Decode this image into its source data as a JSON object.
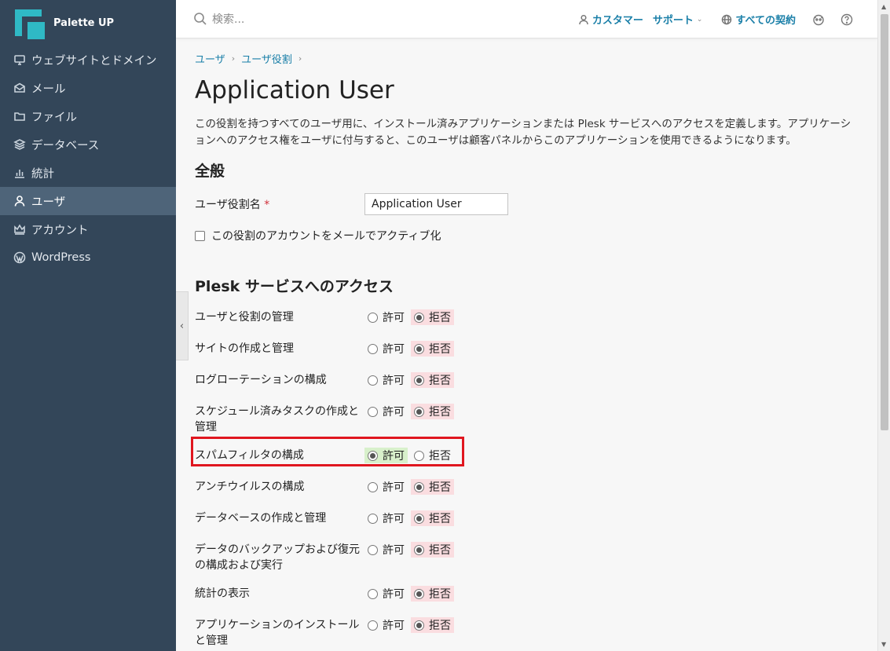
{
  "sidebar": {
    "brand": "Palette UP",
    "items": [
      {
        "label": "ウェブサイトとドメイン",
        "icon": "monitor-icon"
      },
      {
        "label": "メール",
        "icon": "mail-icon"
      },
      {
        "label": "ファイル",
        "icon": "folder-icon"
      },
      {
        "label": "データベース",
        "icon": "database-icon"
      },
      {
        "label": "統計",
        "icon": "stats-icon"
      },
      {
        "label": "ユーザ",
        "icon": "user-icon",
        "active": true
      },
      {
        "label": "アカウント",
        "icon": "crown-icon"
      },
      {
        "label": "WordPress",
        "icon": "wordpress-icon"
      }
    ]
  },
  "header": {
    "search_placeholder": "検索...",
    "customer": "カスタマー",
    "support": "サポート",
    "subscriptions": "すべての契約"
  },
  "breadcrumb": [
    "ユーザ",
    "ユーザ役割"
  ],
  "page": {
    "title": "Application User",
    "description": "この役割を持つすべてのユーザ用に、インストール済みアプリケーションまたは Plesk サービスへのアクセスを定義します。アプリケーションへのアクセス権をユーザに付与すると、このユーザは顧客パネルからこのアプリケーションを使用できるようになります。"
  },
  "general": {
    "heading": "全般",
    "role_name_label": "ユーザ役割名",
    "required_mark": "*",
    "role_name_value": "Application User",
    "activate_label": "この役割のアカウントをメールでアクティブ化"
  },
  "access": {
    "heading": "Plesk サービスへのアクセス",
    "allow_label": "許可",
    "deny_label": "拒否",
    "permissions": [
      {
        "label": "ユーザと役割の管理",
        "value": "deny"
      },
      {
        "label": "サイトの作成と管理",
        "value": "deny"
      },
      {
        "label": "ログローテーションの構成",
        "value": "deny"
      },
      {
        "label": "スケジュール済みタスクの作成と管理",
        "value": "deny"
      },
      {
        "label": "スパムフィルタの構成",
        "value": "allow",
        "highlighted": true
      },
      {
        "label": "アンチウイルスの構成",
        "value": "deny"
      },
      {
        "label": "データベースの作成と管理",
        "value": "deny"
      },
      {
        "label": "データのバックアップおよび復元の構成および実行",
        "value": "deny"
      },
      {
        "label": "統計の表示",
        "value": "deny"
      },
      {
        "label": "アプリケーションのインストールと管理",
        "value": "deny"
      }
    ]
  },
  "colors": {
    "sidebar_bg": "#334659",
    "sidebar_active": "#4e6479",
    "link": "#1a7fa8",
    "deny_bg": "#fadde0",
    "allow_bg": "#d8f0cb",
    "highlight_border": "#e0161f"
  }
}
